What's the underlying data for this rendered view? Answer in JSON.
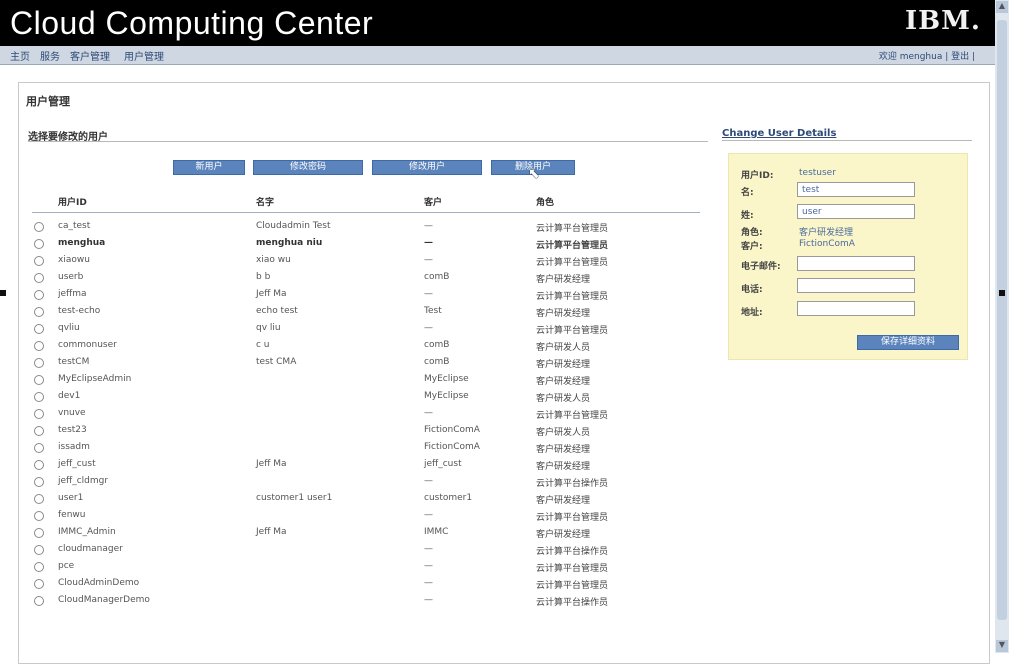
{
  "app": {
    "title": "Cloud Computing Center",
    "brand": "IBM."
  },
  "nav": {
    "items": [
      "主页",
      "服务",
      "客户管理",
      "用户管理"
    ],
    "user_text": "欢迎 menghua | 登出 |"
  },
  "page": {
    "title": "用户管理",
    "section_title": "选择要修改的用户"
  },
  "buttons": [
    "新用户",
    "修改密码",
    "修改用户",
    "删除用户"
  ],
  "table": {
    "headers": [
      "用户ID",
      "名字",
      "客户",
      "角色"
    ],
    "rows": [
      [
        "ca_test",
        "Cloudadmin Test",
        "—",
        "云计算平台管理员"
      ],
      [
        "menghua",
        "menghua niu",
        "—",
        "云计算平台管理员"
      ],
      [
        "xiaowu",
        "xiao wu",
        "—",
        "云计算平台管理员"
      ],
      [
        "userb",
        "b b",
        "comB",
        "客户研发经理"
      ],
      [
        "jeffma",
        "Jeff Ma",
        "—",
        "云计算平台管理员"
      ],
      [
        "test-echo",
        "echo test",
        "Test",
        "客户研发经理"
      ],
      [
        "qvliu",
        "qv liu",
        "—",
        "云计算平台管理员"
      ],
      [
        "commonuser",
        "c u",
        "comB",
        "客户研发人员"
      ],
      [
        "testCM",
        "test CMA",
        "comB",
        "客户研发经理"
      ],
      [
        "MyEclipseAdmin",
        "",
        "MyEclipse",
        "客户研发经理"
      ],
      [
        "dev1",
        "",
        "MyEclipse",
        "客户研发人员"
      ],
      [
        "vnuve",
        "",
        "—",
        "云计算平台管理员"
      ],
      [
        "test23",
        "",
        "FictionComA",
        "客户研发人员"
      ],
      [
        "issadm",
        "",
        "FictionComA",
        "客户研发经理"
      ],
      [
        "jeff_cust",
        "Jeff Ma",
        "jeff_cust",
        "客户研发经理"
      ],
      [
        "jeff_cldmgr",
        "",
        "—",
        "云计算平台操作员"
      ],
      [
        "user1",
        "customer1 user1",
        "customer1",
        "客户研发经理"
      ],
      [
        "fenwu",
        "",
        "—",
        "云计算平台管理员"
      ],
      [
        "IMMC_Admin",
        "Jeff Ma",
        "IMMC",
        "客户研发经理"
      ],
      [
        "cloudmanager",
        "",
        "—",
        "云计算平台操作员"
      ],
      [
        "pce",
        "",
        "—",
        "云计算平台管理员"
      ],
      [
        "CloudAdminDemo",
        "",
        "—",
        "云计算平台管理员"
      ],
      [
        "CloudManagerDemo",
        "",
        "—",
        "云计算平台操作员"
      ]
    ]
  },
  "details": {
    "title": "Change User Details",
    "user_id_label": "用户ID:",
    "user_id": "testuser",
    "first_label": "名:",
    "first_value": "test",
    "last_label": "姓:",
    "last_value": "user",
    "role_label": "角色:",
    "role_value": "客户研发经理",
    "customer_label": "客户:",
    "customer_value": "FictionComA",
    "email_label": "电子邮件:",
    "email_value": "",
    "phone_label": "电话:",
    "phone_value": "",
    "address_label": "地址:",
    "address_value": "",
    "save_label": "保存详细资料"
  }
}
